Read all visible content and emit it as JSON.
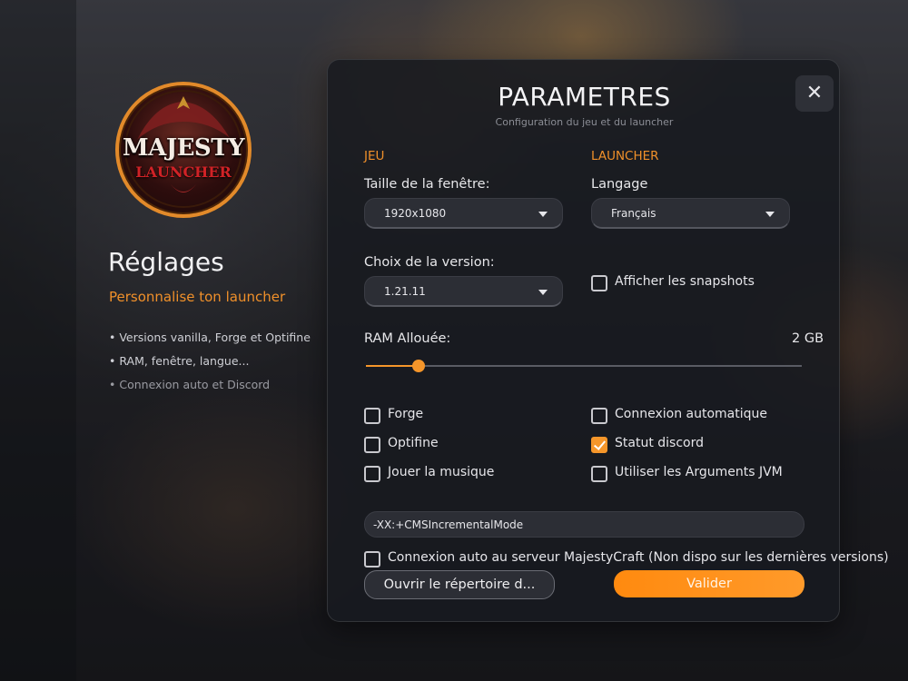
{
  "colors": {
    "accent": "#f5962a",
    "panel_bg": "#181a20",
    "input_bg": "#2c2e35"
  },
  "logo": {
    "title": "MAJESTY",
    "subtitle": "LAUNCHER"
  },
  "sidebar": {
    "title": "Réglages",
    "subtitle": "Personnalise ton launcher",
    "bullets": [
      "• Versions vanilla, Forge et Optifine",
      "• RAM, fenêtre, langue...",
      "• Connexion auto et Discord"
    ]
  },
  "panel": {
    "title": "PARAMETRES",
    "subtitle": "Configuration du jeu et du launcher",
    "close_icon": "close-icon",
    "sections": {
      "game": "JEU",
      "launcher": "LAUNCHER"
    },
    "window_size": {
      "label": "Taille de la fenêtre:",
      "value": "1920x1080"
    },
    "language": {
      "label": "Langage",
      "value": "Français"
    },
    "version": {
      "label": "Choix de la version:",
      "value": "1.21.11"
    },
    "snapshots": {
      "label": "Afficher les snapshots",
      "checked": false
    },
    "ram": {
      "label": "RAM Allouée:",
      "value_label": "2 GB",
      "fraction": 0.12
    },
    "options_left": [
      {
        "label": "Forge",
        "checked": false
      },
      {
        "label": "Optifine",
        "checked": false
      },
      {
        "label": "Jouer la musique",
        "checked": false
      }
    ],
    "options_right": [
      {
        "label": "Connexion automatique",
        "checked": false
      },
      {
        "label": "Statut discord",
        "checked": true
      },
      {
        "label": "Utiliser les Arguments JVM",
        "checked": false
      }
    ],
    "jvm_args": {
      "value": "-XX:+CMSIncrementalMode"
    },
    "auto_connect": {
      "label": "Connexion auto au serveur MajestyCraft (Non dispo sur les dernières versions)",
      "checked": false
    },
    "open_dir_label": "Ouvrir le répertoire d...",
    "validate_label": "Valider"
  }
}
